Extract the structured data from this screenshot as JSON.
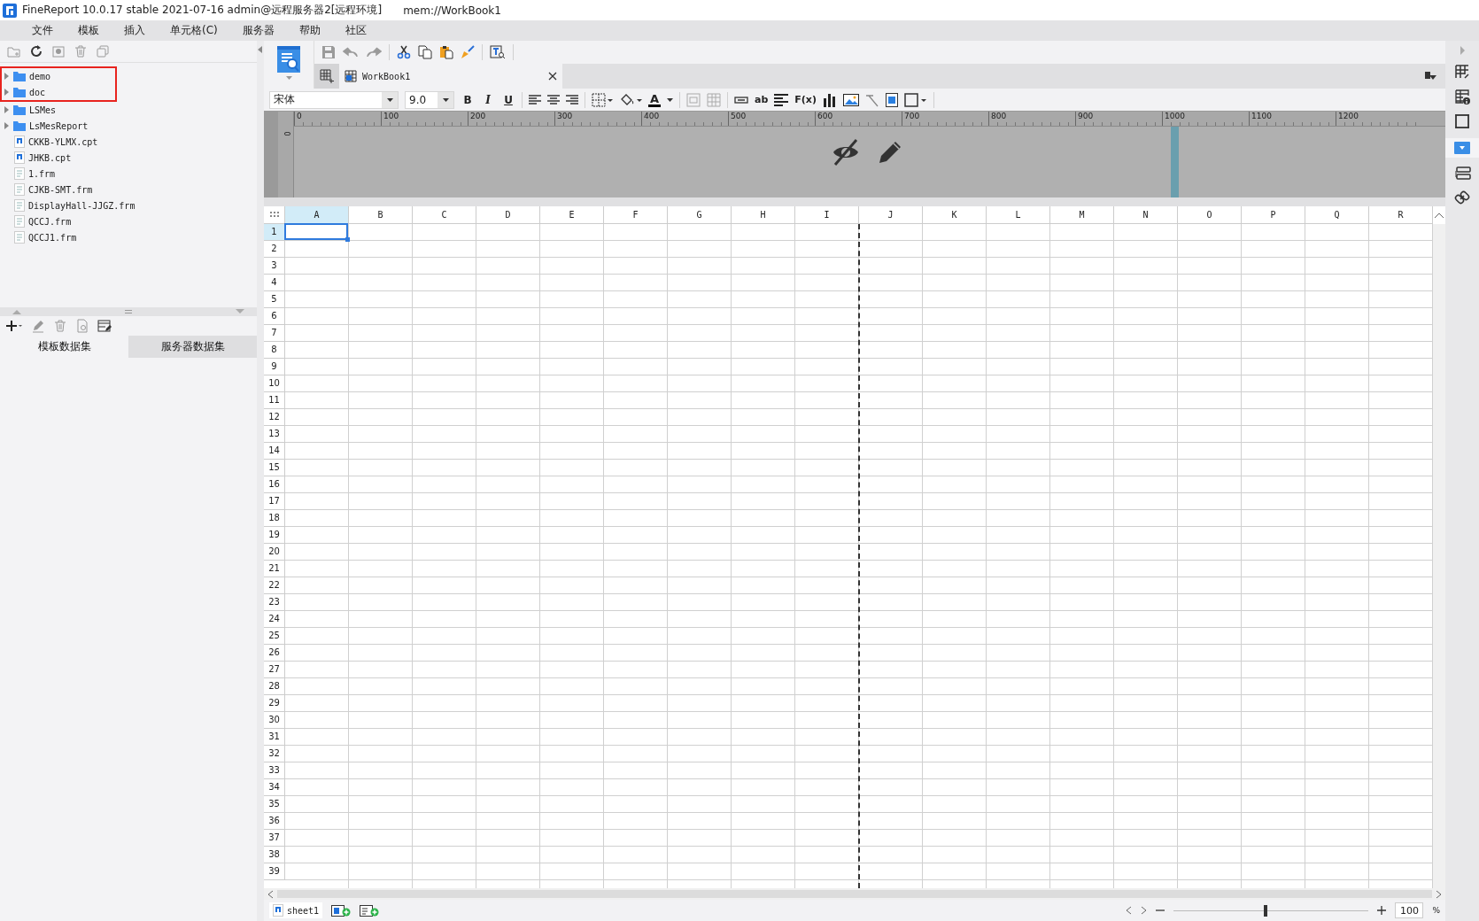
{
  "window": {
    "title": "FineReport 10.0.17 stable 2021-07-16 admin@远程服务器2[远程环境]",
    "path": "mem://WorkBook1"
  },
  "menu": [
    {
      "label": "文件"
    },
    {
      "label": "模板"
    },
    {
      "label": "插入"
    },
    {
      "label": "单元格(C)"
    },
    {
      "label": "服务器"
    },
    {
      "label": "帮助"
    },
    {
      "label": "社区"
    }
  ],
  "file_tree": [
    {
      "name": "demo",
      "kind": "folder",
      "marked": true
    },
    {
      "name": "doc",
      "kind": "folder",
      "marked": true
    },
    {
      "name": "LSMes",
      "kind": "folder",
      "marked": false
    },
    {
      "name": "LsMesReport",
      "kind": "folder",
      "marked": false
    },
    {
      "name": "CKKB-YLMX.cpt",
      "kind": "report",
      "marked": false
    },
    {
      "name": "JHKB.cpt",
      "kind": "report",
      "marked": false
    },
    {
      "name": "1.frm",
      "kind": "form",
      "marked": false
    },
    {
      "name": "CJKB-SMT.frm",
      "kind": "form",
      "marked": false
    },
    {
      "name": "DisplayHall-JJGZ.frm",
      "kind": "form",
      "marked": false
    },
    {
      "name": "QCCJ.frm",
      "kind": "form",
      "marked": false
    },
    {
      "name": "QCCJ1.frm",
      "kind": "form",
      "marked": false
    }
  ],
  "dataset_tabs": [
    {
      "label": "模板数据集",
      "selected": true
    },
    {
      "label": "服务器数据集",
      "selected": false
    }
  ],
  "document_tabs": [
    {
      "label": "WorkBook1",
      "selected": true
    }
  ],
  "format_toolbar": {
    "font": "宋体",
    "size": "9.0",
    "style_buttons": [
      "B",
      "I",
      "U"
    ],
    "font_color_label": "A",
    "text_tool": "ab",
    "formula_tool": "F(x)"
  },
  "ruler": {
    "labels": [
      "0",
      "100",
      "200",
      "300",
      "400",
      "500",
      "600",
      "700",
      "800",
      "900",
      "1000",
      "1100",
      "1200"
    ],
    "vertical_label": "0"
  },
  "sheet": {
    "columns": [
      {
        "label": "A",
        "selected": true,
        "page_break_after": false
      },
      {
        "label": "B",
        "selected": false,
        "page_break_after": false
      },
      {
        "label": "C",
        "selected": false,
        "page_break_after": false
      },
      {
        "label": "D",
        "selected": false,
        "page_break_after": false
      },
      {
        "label": "E",
        "selected": false,
        "page_break_after": false
      },
      {
        "label": "F",
        "selected": false,
        "page_break_after": false
      },
      {
        "label": "G",
        "selected": false,
        "page_break_after": false
      },
      {
        "label": "H",
        "selected": false,
        "page_break_after": false
      },
      {
        "label": "I",
        "selected": false,
        "page_break_after": true
      },
      {
        "label": "J",
        "selected": false,
        "page_break_after": false
      },
      {
        "label": "K",
        "selected": false,
        "page_break_after": false
      },
      {
        "label": "L",
        "selected": false,
        "page_break_after": false
      },
      {
        "label": "M",
        "selected": false,
        "page_break_after": false
      },
      {
        "label": "N",
        "selected": false,
        "page_break_after": false
      },
      {
        "label": "O",
        "selected": false,
        "page_break_after": false
      },
      {
        "label": "P",
        "selected": false,
        "page_break_after": false
      },
      {
        "label": "Q",
        "selected": false,
        "page_break_after": false
      },
      {
        "label": "R",
        "selected": false,
        "page_break_after": false
      }
    ],
    "rows": [
      {
        "label": "1",
        "selected": true
      },
      {
        "label": "2",
        "selected": false
      },
      {
        "label": "3",
        "selected": false
      },
      {
        "label": "4",
        "selected": false
      },
      {
        "label": "5",
        "selected": false
      },
      {
        "label": "6",
        "selected": false
      },
      {
        "label": "7",
        "selected": false
      },
      {
        "label": "8",
        "selected": false
      },
      {
        "label": "9",
        "selected": false
      },
      {
        "label": "10",
        "selected": false
      },
      {
        "label": "11",
        "selected": false
      },
      {
        "label": "12",
        "selected": false
      },
      {
        "label": "13",
        "selected": false
      },
      {
        "label": "14",
        "selected": false
      },
      {
        "label": "15",
        "selected": false
      },
      {
        "label": "16",
        "selected": false
      },
      {
        "label": "17",
        "selected": false
      },
      {
        "label": "18",
        "selected": false
      },
      {
        "label": "19",
        "selected": false
      },
      {
        "label": "20",
        "selected": false
      },
      {
        "label": "21",
        "selected": false
      },
      {
        "label": "22",
        "selected": false
      },
      {
        "label": "23",
        "selected": false
      },
      {
        "label": "24",
        "selected": false
      },
      {
        "label": "25",
        "selected": false
      },
      {
        "label": "26",
        "selected": false
      },
      {
        "label": "27",
        "selected": false
      },
      {
        "label": "28",
        "selected": false
      },
      {
        "label": "29",
        "selected": false
      },
      {
        "label": "30",
        "selected": false
      },
      {
        "label": "31",
        "selected": false
      },
      {
        "label": "32",
        "selected": false
      },
      {
        "label": "33",
        "selected": false
      },
      {
        "label": "34",
        "selected": false
      },
      {
        "label": "35",
        "selected": false
      },
      {
        "label": "36",
        "selected": false
      },
      {
        "label": "37",
        "selected": false
      },
      {
        "label": "38",
        "selected": false
      },
      {
        "label": "39",
        "selected": false
      }
    ]
  },
  "sheet_tabs": [
    {
      "label": "sheet1",
      "selected": true
    }
  ],
  "zoom": {
    "value": "100",
    "unit": "%",
    "level": 0.47
  }
}
